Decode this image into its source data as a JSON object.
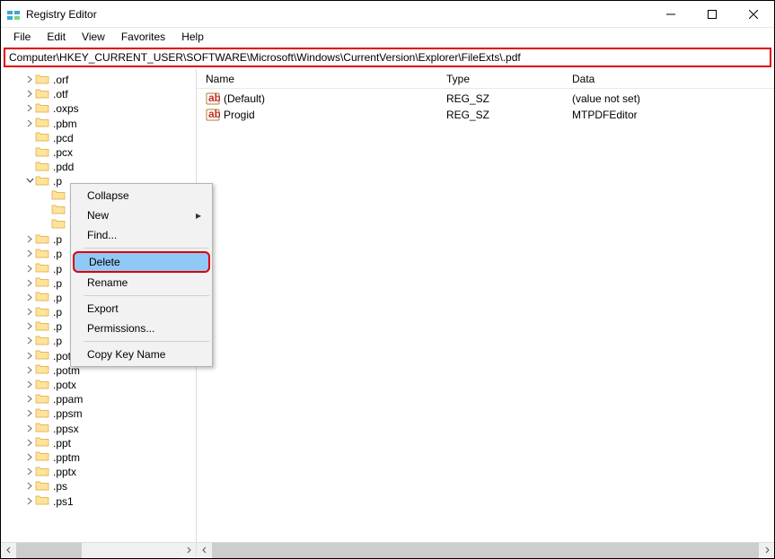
{
  "window": {
    "title": "Registry Editor"
  },
  "menu": {
    "file": "File",
    "edit": "Edit",
    "view": "View",
    "favorites": "Favorites",
    "help": "Help"
  },
  "address": "Computer\\HKEY_CURRENT_USER\\SOFTWARE\\Microsoft\\Windows\\CurrentVersion\\Explorer\\FileExts\\.pdf",
  "tree": {
    "items": [
      {
        "indent": 1,
        "exp": "closed",
        "label": ".orf"
      },
      {
        "indent": 1,
        "exp": "closed",
        "label": ".otf"
      },
      {
        "indent": 1,
        "exp": "closed",
        "label": ".oxps"
      },
      {
        "indent": 1,
        "exp": "closed",
        "label": ".pbm"
      },
      {
        "indent": 1,
        "exp": "none",
        "label": ".pcd"
      },
      {
        "indent": 1,
        "exp": "none",
        "label": ".pcx"
      },
      {
        "indent": 1,
        "exp": "none",
        "label": ".pdd"
      },
      {
        "indent": 1,
        "exp": "open",
        "label": ".p"
      },
      {
        "indent": 2,
        "exp": "none",
        "label": ""
      },
      {
        "indent": 2,
        "exp": "none",
        "label": ""
      },
      {
        "indent": 2,
        "exp": "none",
        "label": ""
      },
      {
        "indent": 1,
        "exp": "closed",
        "label": ".p"
      },
      {
        "indent": 1,
        "exp": "closed",
        "label": ".p"
      },
      {
        "indent": 1,
        "exp": "closed",
        "label": ".p"
      },
      {
        "indent": 1,
        "exp": "closed",
        "label": ".p"
      },
      {
        "indent": 1,
        "exp": "closed",
        "label": ".p"
      },
      {
        "indent": 1,
        "exp": "closed",
        "label": ".p"
      },
      {
        "indent": 1,
        "exp": "closed",
        "label": ".p"
      },
      {
        "indent": 1,
        "exp": "closed",
        "label": ".p"
      },
      {
        "indent": 1,
        "exp": "closed",
        "label": ".pot"
      },
      {
        "indent": 1,
        "exp": "closed",
        "label": ".potm"
      },
      {
        "indent": 1,
        "exp": "closed",
        "label": ".potx"
      },
      {
        "indent": 1,
        "exp": "closed",
        "label": ".ppam"
      },
      {
        "indent": 1,
        "exp": "closed",
        "label": ".ppsm"
      },
      {
        "indent": 1,
        "exp": "closed",
        "label": ".ppsx"
      },
      {
        "indent": 1,
        "exp": "closed",
        "label": ".ppt"
      },
      {
        "indent": 1,
        "exp": "closed",
        "label": ".pptm"
      },
      {
        "indent": 1,
        "exp": "closed",
        "label": ".pptx"
      },
      {
        "indent": 1,
        "exp": "closed",
        "label": ".ps"
      },
      {
        "indent": 1,
        "exp": "closed",
        "label": ".ps1"
      }
    ]
  },
  "columns": {
    "name": "Name",
    "type": "Type",
    "data": "Data"
  },
  "values": [
    {
      "name": "(Default)",
      "type": "REG_SZ",
      "data": "(value not set)"
    },
    {
      "name": "Progid",
      "type": "REG_SZ",
      "data": "MTPDFEditor"
    }
  ],
  "context_menu": {
    "collapse": "Collapse",
    "new": "New",
    "find": "Find...",
    "delete": "Delete",
    "rename": "Rename",
    "export": "Export",
    "permissions": "Permissions...",
    "copykey": "Copy Key Name"
  }
}
